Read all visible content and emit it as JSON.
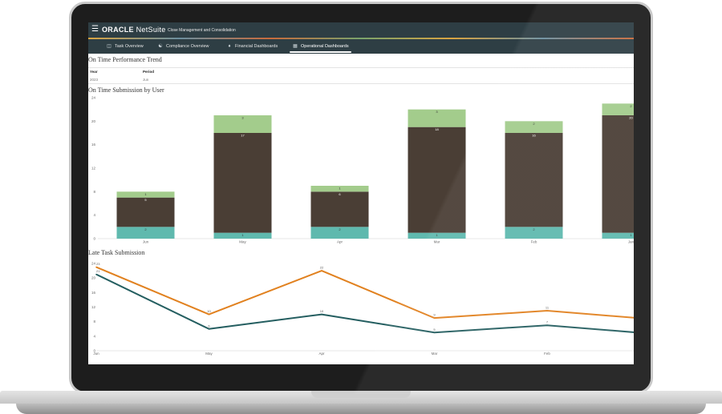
{
  "topbar": {
    "menu_icon": "hamburger-icon",
    "brand_oracle": "ORACLE",
    "brand_netsuite": "NetSuite",
    "app_name": "Close Management and Consolidation"
  },
  "tabs": [
    {
      "label": "Task Overview",
      "icon": "panel-icon",
      "active": false
    },
    {
      "label": "Compliance Overview",
      "icon": "people-icon",
      "active": false
    },
    {
      "label": "Financial Dashboards",
      "icon": "bag-icon",
      "active": false
    },
    {
      "label": "Operational Dashboards",
      "icon": "dashboard-icon",
      "active": true
    }
  ],
  "performance": {
    "title": "On Time Performance Trend",
    "year_header": "Year",
    "period_header": "Period",
    "year_value": "2023",
    "period_value": "Jun"
  },
  "colors": {
    "bar_bottom": "#5fb9ae",
    "bar_middle": "#4a3e35",
    "bar_top": "#a3cc8c",
    "line_orange": "#e1811f",
    "line_teal": "#245e60",
    "nav_bg": "#2e3e44"
  },
  "chart_data": [
    {
      "type": "bar",
      "title": "On Time Submission by User",
      "categories": [
        "Jun",
        "May",
        "Apr",
        "Mar",
        "Feb",
        "Jan"
      ],
      "ylim": [
        0,
        24
      ],
      "yticks": [
        "0",
        "4",
        "8",
        "12",
        "16",
        "20",
        "24"
      ],
      "stacked": true,
      "series": [
        {
          "values": [
            2,
            1,
            2,
            1,
            2,
            1
          ],
          "labels": [
            "2",
            "1",
            "2",
            "1",
            "2",
            "1"
          ]
        },
        {
          "values": [
            5,
            17,
            6,
            18,
            16,
            20
          ],
          "labels": [
            "5",
            "17",
            "6",
            "18",
            "16",
            "20"
          ]
        },
        {
          "values": [
            1,
            3,
            1,
            3,
            2,
            2
          ],
          "labels": [
            "1",
            "3",
            "1",
            "3",
            "2",
            "2"
          ]
        }
      ],
      "grid": false,
      "legend": "none"
    },
    {
      "type": "line",
      "title": "Late Task Submission",
      "categories": [
        "Jun",
        "May",
        "Apr",
        "Mar",
        "Feb",
        "Jan"
      ],
      "ylim": [
        0,
        24
      ],
      "yticks": [
        "0",
        "4",
        "8",
        "12",
        "16",
        "20",
        "24"
      ],
      "series": [
        {
          "values": [
            23,
            10,
            22,
            9,
            11,
            8.5
          ],
          "labels": [
            "23",
            "10",
            "22",
            "9",
            "11",
            ""
          ]
        },
        {
          "values": [
            21,
            6,
            10,
            5,
            7,
            4.5
          ],
          "labels": [
            "21",
            "6",
            "10",
            "5",
            "7",
            ""
          ]
        }
      ],
      "grid": false,
      "legend": "none"
    }
  ]
}
